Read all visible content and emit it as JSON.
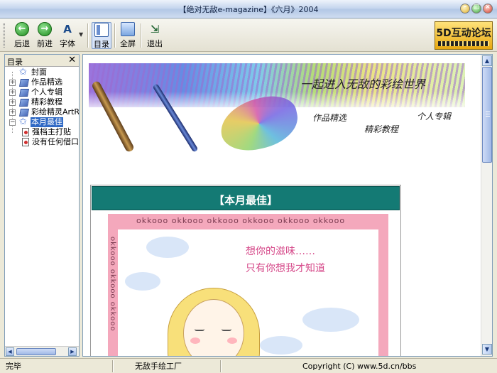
{
  "window": {
    "title": "【绝对无敌e-magazine】《六月》2004"
  },
  "toolbar": {
    "back": "后退",
    "forward": "前进",
    "font": "字体",
    "toc": "目录",
    "fullscreen": "全屏",
    "exit": "退出",
    "logo": "5D互动论坛"
  },
  "sidebar": {
    "title": "目录",
    "close_glyph": "✕",
    "items": [
      {
        "label": "封面",
        "icon": "star-icon",
        "expandable": false
      },
      {
        "label": "作品精选",
        "icon": "book-icon",
        "expandable": true
      },
      {
        "label": "个人专辑",
        "icon": "book-icon",
        "expandable": true
      },
      {
        "label": "精彩教程",
        "icon": "book-icon",
        "expandable": true
      },
      {
        "label": "彩绘精灵ArtRa",
        "icon": "book-icon",
        "expandable": true
      },
      {
        "label": "本月最佳",
        "icon": "star-icon",
        "expandable": true,
        "selected": true
      },
      {
        "label": "强档主打贴",
        "icon": "document-icon",
        "expandable": false
      },
      {
        "label": "没有任何借口",
        "icon": "document-icon",
        "expandable": false
      }
    ]
  },
  "banner": {
    "slogan": "一起进入无敌的彩绘世界",
    "links": [
      "作品精选",
      "个人专辑",
      "精彩教程"
    ]
  },
  "section": {
    "title": "【本月最佳】",
    "frame_text": "okkooo okkooo okkooo okkooo okkooo okkooo",
    "side_text": "okkooo okkooo okkooo",
    "poem_line1": "想你的滋味……",
    "poem_line2": "只有你想我才知道"
  },
  "status": {
    "left": "完毕",
    "middle": "无敌手绘工厂",
    "right": "Copyright (C) www.5d.cn/bbs"
  }
}
